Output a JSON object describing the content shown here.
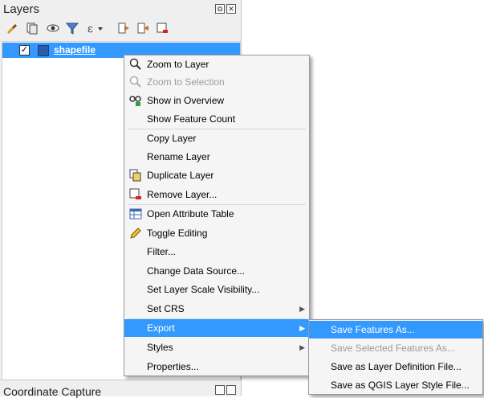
{
  "panel": {
    "title": "Layers",
    "restore_glyph": "⧉",
    "close_glyph": "✕"
  },
  "toolbar": {
    "icons": [
      "paint-brush-icon",
      "add-group-icon",
      "eye-icon",
      "filter-icon",
      "expression-filter-icon",
      "expand-all-icon",
      "collapse-all-icon",
      "remove-layer-icon"
    ]
  },
  "layer": {
    "name": "shapefile",
    "checked_glyph": "✓",
    "swatch_color": "#2a5caa"
  },
  "context_menu": {
    "items": [
      {
        "label": "Zoom to Layer",
        "icon": "zoom-layer-icon",
        "disabled": false
      },
      {
        "label": "Zoom to Selection",
        "icon": "zoom-selection-icon",
        "disabled": true
      },
      {
        "label": "Show in Overview",
        "icon": "overview-icon",
        "disabled": false
      },
      {
        "label": "Show Feature Count",
        "icon": "",
        "disabled": false
      },
      {
        "label": "Copy Layer",
        "icon": "",
        "disabled": false
      },
      {
        "label": "Rename Layer",
        "icon": "",
        "disabled": false
      },
      {
        "label": "Duplicate Layer",
        "icon": "duplicate-icon",
        "disabled": false
      },
      {
        "label": "Remove Layer...",
        "icon": "remove-icon",
        "disabled": false
      },
      {
        "label": "Open Attribute Table",
        "icon": "table-icon",
        "disabled": false
      },
      {
        "label": "Toggle Editing",
        "icon": "pencil-icon",
        "disabled": false
      },
      {
        "label": "Filter...",
        "icon": "",
        "disabled": false
      },
      {
        "label": "Change Data Source...",
        "icon": "",
        "disabled": false
      },
      {
        "label": "Set Layer Scale Visibility...",
        "icon": "",
        "disabled": false
      },
      {
        "label": "Set CRS",
        "icon": "",
        "disabled": false,
        "submenu": true
      },
      {
        "label": "Export",
        "icon": "",
        "disabled": false,
        "submenu": true,
        "highlighted": true
      },
      {
        "label": "Styles",
        "icon": "",
        "disabled": false,
        "submenu": true
      },
      {
        "label": "Properties...",
        "icon": "",
        "disabled": false
      }
    ]
  },
  "export_submenu": {
    "items": [
      {
        "label": "Save Features As...",
        "disabled": false,
        "highlighted": true
      },
      {
        "label": "Save Selected Features As...",
        "disabled": true
      },
      {
        "label": "Save as Layer Definition File...",
        "disabled": false
      },
      {
        "label": "Save as QGIS Layer Style File...",
        "disabled": false
      }
    ]
  },
  "next_panel": {
    "title": "Coordinate Capture"
  },
  "colors": {
    "highlight": "#3399ff",
    "menu_bg": "#f5f5f5",
    "disabled_text": "#9a9a9a"
  }
}
